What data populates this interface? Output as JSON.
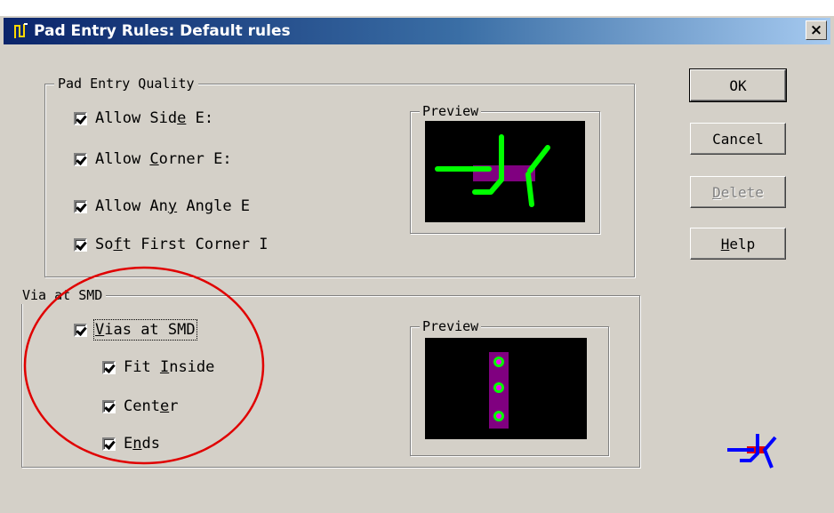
{
  "dialog": {
    "title": "Pad Entry Rules: Default rules",
    "close_label": "×"
  },
  "pad_entry_quality": {
    "legend": "Pad Entry Quality",
    "options": [
      {
        "pre": "Allow Sid",
        "mn": "e",
        "post": " E:",
        "checked": true
      },
      {
        "pre": "Allow ",
        "mn": "C",
        "post": "orner E:",
        "checked": true
      },
      {
        "pre": "Allow An",
        "mn": "y",
        "post": " Angle E",
        "checked": true
      },
      {
        "pre": "So",
        "mn": "f",
        "post": "t First Corner I",
        "checked": true
      }
    ],
    "preview_label": "Preview"
  },
  "via_at_smd": {
    "legend": "Via at SMD",
    "main_option": {
      "pre": "",
      "mn": "V",
      "post": "ias at SMD",
      "checked": true
    },
    "sub_options": [
      {
        "pre": "Fit ",
        "mn": "I",
        "post": "nside",
        "checked": true
      },
      {
        "pre": "Cent",
        "mn": "e",
        "post": "r",
        "checked": true
      },
      {
        "pre": "E",
        "mn": "n",
        "post": "ds",
        "checked": true
      }
    ],
    "preview_label": "Preview"
  },
  "buttons": {
    "ok": {
      "label": "OK",
      "enabled": true
    },
    "cancel": {
      "label": "Cancel",
      "enabled": true
    },
    "delete": {
      "pre": "",
      "mn": "D",
      "post": "elete",
      "enabled": false
    },
    "help": {
      "pre": "",
      "mn": "H",
      "post": "elp",
      "enabled": true
    }
  },
  "colors": {
    "canvas_bg": "#000000",
    "trace_green": "#00ff00",
    "pad_purple": "#800080",
    "via_magenta": "#ff00ff",
    "annotation_red": "#e00000",
    "icon_blue": "#0000ff"
  },
  "icons": {
    "title_icon": "routing-icon",
    "footer_icon": "pad-entry-icon"
  }
}
